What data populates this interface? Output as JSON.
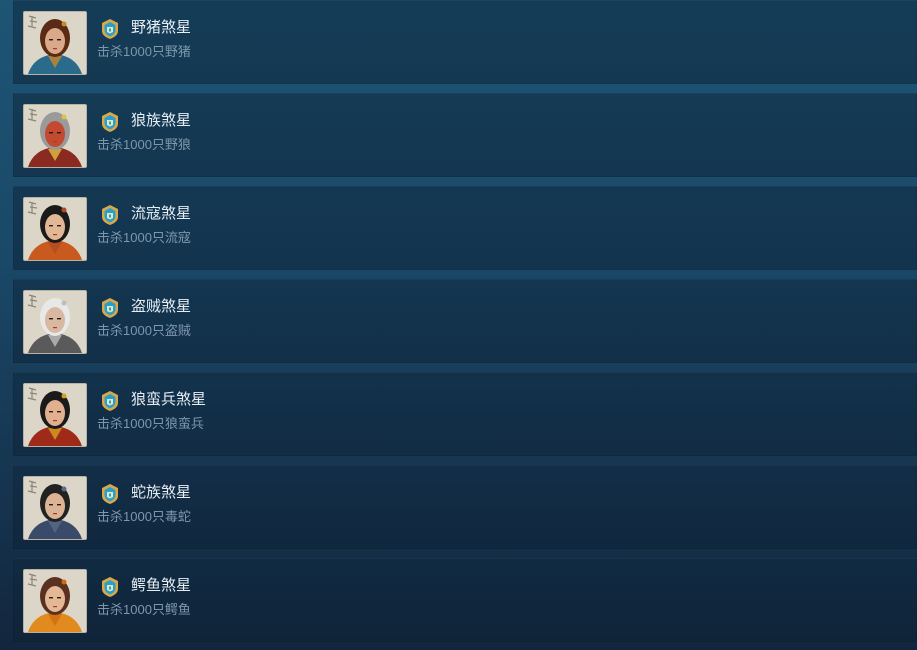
{
  "achievements": [
    {
      "title": "野猪煞星",
      "desc": "击杀1000只野猪",
      "colors": {
        "hair": "#5a2a14",
        "skin": "#d9a98a",
        "cloth": "#2a6a8a",
        "accent": "#c98a2a"
      }
    },
    {
      "title": "狼族煞星",
      "desc": "击杀1000只野狼",
      "colors": {
        "hair": "#9a9a9a",
        "skin": "#c24a30",
        "cloth": "#8a2a20",
        "accent": "#e0c040"
      }
    },
    {
      "title": "流寇煞星",
      "desc": "击杀1000只流寇",
      "colors": {
        "hair": "#1a1a1a",
        "skin": "#e2b796",
        "cloth": "#c85a20",
        "accent": "#b04a20"
      }
    },
    {
      "title": "盗贼煞星",
      "desc": "击杀1000只盗贼",
      "colors": {
        "hair": "#e8e8e8",
        "skin": "#d8b8a0",
        "cloth": "#5a5a5a",
        "accent": "#bdbdbd"
      }
    },
    {
      "title": "狼蛮兵煞星",
      "desc": "击杀1000只狼蛮兵",
      "colors": {
        "hair": "#1a1a1a",
        "skin": "#e0b090",
        "cloth": "#a02a1a",
        "accent": "#d8a020"
      }
    },
    {
      "title": "蛇族煞星",
      "desc": "击杀1000只毒蛇",
      "colors": {
        "hair": "#222222",
        "skin": "#dcb394",
        "cloth": "#3a4a6a",
        "accent": "#5a6a8a"
      }
    },
    {
      "title": "鳄鱼煞星",
      "desc": "击杀1000只鳄鱼",
      "colors": {
        "hair": "#5a3020",
        "skin": "#e4b896",
        "cloth": "#e08a20",
        "accent": "#d06a10"
      }
    }
  ],
  "badge_icon": "achievement-badge-icon",
  "badge_colors": {
    "outer": "#d8a84a",
    "inner": "#2aa0c8",
    "mark": "#f4f0c8"
  }
}
